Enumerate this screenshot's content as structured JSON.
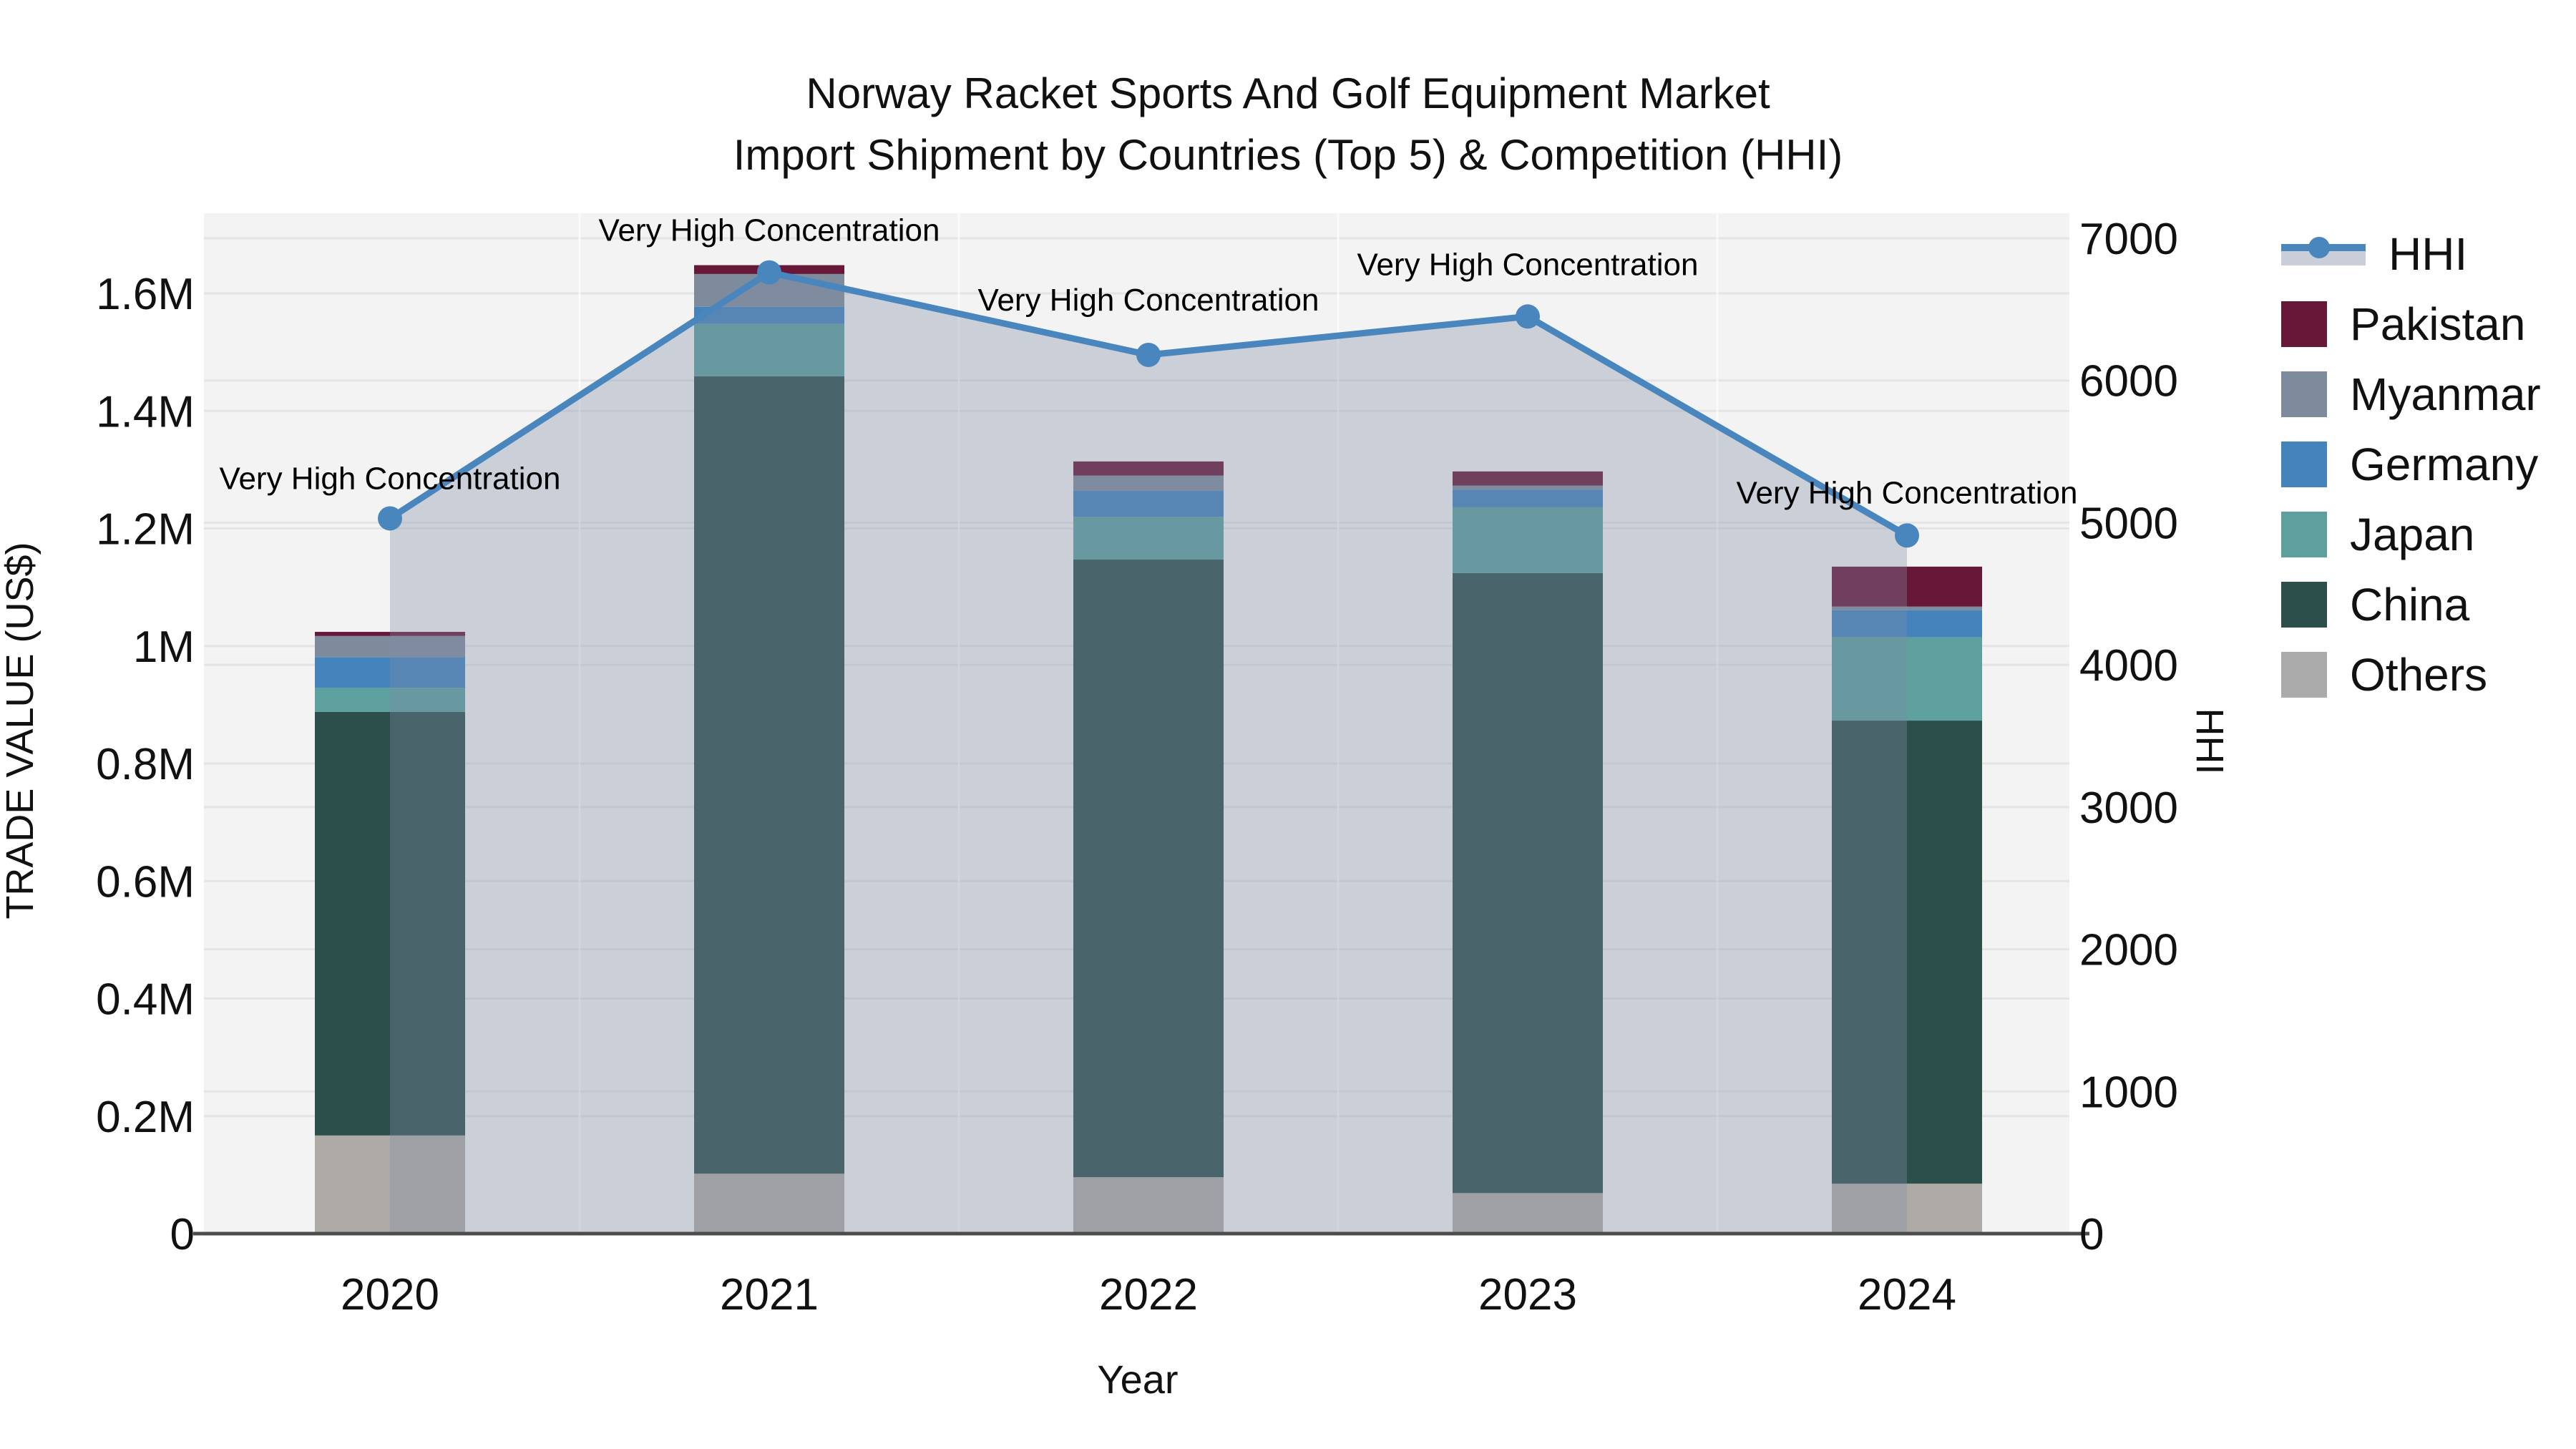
{
  "title": {
    "line1": "Norway Racket Sports And Golf Equipment Market",
    "line2": "Import Shipment by Countries (Top 5) & Competition (HHI)"
  },
  "axes": {
    "x_label": "Year",
    "y_left_label": "TRADE VALUE (US$)",
    "y_right_label": "HHI"
  },
  "legend": {
    "items": [
      {
        "label": "HHI",
        "type": "line",
        "color": "#4a86be",
        "band": "#c9ced8"
      },
      {
        "label": "Pakistan",
        "type": "box",
        "color": "#671737"
      },
      {
        "label": "Myanmar",
        "type": "box",
        "color": "#7e8b9c"
      },
      {
        "label": "Germany",
        "type": "box",
        "color": "#4483bb"
      },
      {
        "label": "Japan",
        "type": "box",
        "color": "#5da09d"
      },
      {
        "label": "China",
        "type": "box",
        "color": "#2d4f4b"
      },
      {
        "label": "Others",
        "type": "box",
        "color": "#ababab"
      }
    ]
  },
  "chart_data": {
    "type": "bar",
    "subtype": "stacked-bars-with-line",
    "title": "Norway Racket Sports And Golf Equipment Market Import Shipment by Countries (Top 5) & Competition (HHI)",
    "xlabel": "Year",
    "ylabel_left": "TRADE VALUE (US$)",
    "ylabel_right": "HHI",
    "categories": [
      "2020",
      "2021",
      "2022",
      "2023",
      "2024"
    ],
    "units": "millions USD",
    "ylim_left_m": [
      0,
      1.734
    ],
    "ylim_right": [
      0,
      7000
    ],
    "grid": true,
    "plot_bg": "#f2f3f2",
    "grid_color": "#e3e4e5",
    "axis_line_color": "#4c4c4c",
    "text_color": "#111111",
    "y_left_ticks": {
      "values_m": [
        0,
        0.2,
        0.4,
        0.6,
        0.8,
        1.0,
        1.2,
        1.4,
        1.6
      ],
      "labels": [
        "0",
        "0.2M",
        "0.4M",
        "0.6M",
        "0.8M",
        "1M",
        "1.2M",
        "1.4M",
        "1.6M"
      ]
    },
    "y_right_ticks": {
      "values": [
        0,
        1000,
        2000,
        3000,
        4000,
        5000,
        6000,
        7000
      ],
      "labels": [
        "0",
        "1000",
        "2000",
        "3000",
        "4000",
        "5000",
        "6000",
        "7000"
      ]
    },
    "series": [
      {
        "name": "Others",
        "color": "#aeaba6",
        "values_m": [
          0.167,
          0.102,
          0.096,
          0.069,
          0.085
        ]
      },
      {
        "name": "China",
        "color": "#2d4f4b",
        "values_m": [
          0.721,
          1.357,
          1.051,
          1.055,
          0.788
        ]
      },
      {
        "name": "Japan",
        "color": "#5da09d",
        "values_m": [
          0.041,
          0.089,
          0.073,
          0.112,
          0.142
        ]
      },
      {
        "name": "Germany",
        "color": "#4483bb",
        "values_m": [
          0.052,
          0.029,
          0.044,
          0.03,
          0.046
        ]
      },
      {
        "name": "Myanmar",
        "color": "#7e8b9c",
        "values_m": [
          0.036,
          0.056,
          0.026,
          0.007,
          0.006
        ]
      },
      {
        "name": "Pakistan",
        "color": "#671737",
        "values_m": [
          0.007,
          0.015,
          0.024,
          0.024,
          0.068
        ]
      }
    ],
    "bar_totals_m": [
      1.024,
      1.648,
      1.314,
      1.297,
      1.135
    ],
    "line": {
      "name": "HHI",
      "values": [
        5030,
        6760,
        6180,
        6450,
        4910
      ],
      "color": "#4a86be",
      "marker": "circle",
      "area_fill": "rgba(130,142,168,0.34)"
    },
    "annotations": [
      {
        "text": "Very High Concentration",
        "year": "2020",
        "dy": -41
      },
      {
        "text": "Very High Concentration",
        "year": "2021",
        "dy": -44
      },
      {
        "text": "Very High Concentration",
        "year": "2022",
        "dy": -62
      },
      {
        "text": "Very High Concentration",
        "year": "2023",
        "dy": -58
      },
      {
        "text": "Very High Concentration",
        "year": "2024",
        "dy": -45
      }
    ],
    "legend_position": "right"
  }
}
